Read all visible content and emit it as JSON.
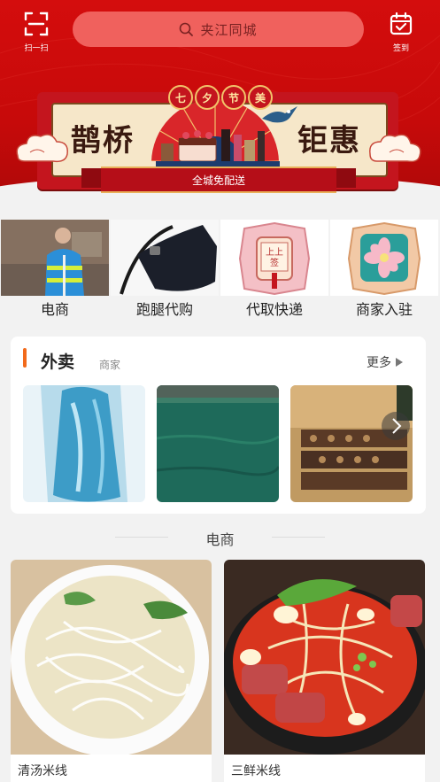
{
  "header": {
    "scan_label": "扫一扫",
    "search_placeholder": "夹江同城",
    "sign_label": "签到",
    "scan_icon": "scan-icon",
    "search_icon": "search-icon",
    "sign_icon": "calendar-check-icon",
    "brand_red": "#d40d0d"
  },
  "banner": {
    "badges": [
      "七",
      "夕",
      "节",
      "美"
    ],
    "left_text": "鹊桥",
    "right_text": "钜惠",
    "ribbon_text": "全城免配送"
  },
  "categories": [
    {
      "label": "电商"
    },
    {
      "label": "跑腿代购"
    },
    {
      "label": "代取快递"
    },
    {
      "label": "商家入驻"
    }
  ],
  "takeout": {
    "title": "外卖",
    "subtitle": "商家",
    "more_label": "更多",
    "more_icon": "triangle-right-icon",
    "accent": "#f26a1b"
  },
  "ecommerce": {
    "section_title": "电商",
    "products": [
      {
        "name": "清汤米线"
      },
      {
        "name": "三鲜米线"
      }
    ]
  }
}
